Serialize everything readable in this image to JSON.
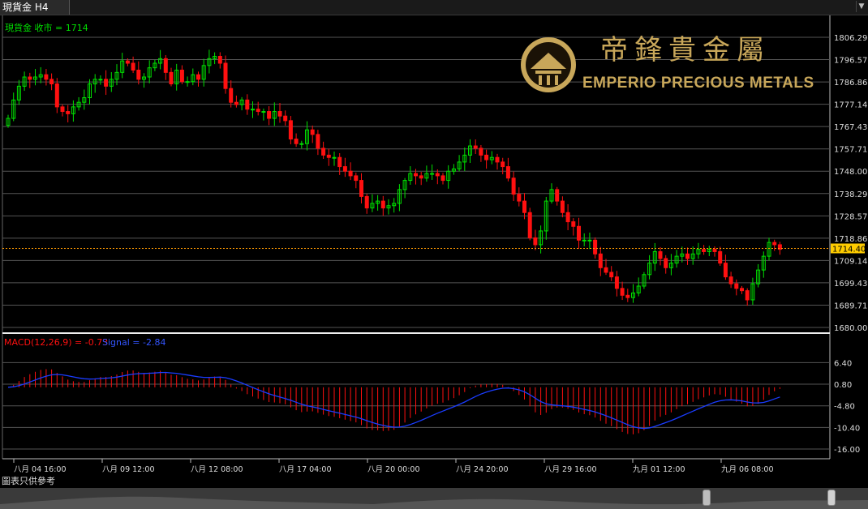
{
  "window": {
    "tab_title": "現貨金 H4",
    "corner_glyph": "▼"
  },
  "logo": {
    "chinese": "帝鋒貴金屬",
    "english": "EMPERIO PRECIOUS METALS"
  },
  "footer": {
    "label": "圖表只供參考"
  },
  "colors": {
    "up": "#00e000",
    "down": "#ff1010",
    "signal": "#1a3cff",
    "macd": "#ff1010",
    "price_line": "#ff9900",
    "grid": "#555555",
    "axis_text": "#dddddd"
  },
  "chart_data": [
    {
      "type": "candlestick",
      "legend": "現貨金 收市 = 1714",
      "current_price": 1714.4,
      "current_price_label": "1714.40",
      "ylim": [
        1680.0,
        1806.29
      ],
      "y_ticks": [
        "1806.29",
        "1796.57",
        "1786.86",
        "1777.14",
        "1767.43",
        "1757.71",
        "1748.00",
        "1738.29",
        "1728.57",
        "1718.86",
        "1709.14",
        "1699.43",
        "1689.71",
        "1680.00"
      ],
      "y_tick_values": [
        1806.29,
        1796.57,
        1786.86,
        1777.14,
        1767.43,
        1757.71,
        1748.0,
        1738.29,
        1728.57,
        1718.86,
        1709.14,
        1699.43,
        1689.71,
        1680.0
      ],
      "x_ticks": [
        "八月 04 16:00",
        "八月 09 12:00",
        "八月 12 08:00",
        "八月 17 04:00",
        "八月 20 00:00",
        "八月 24 20:00",
        "八月 29 16:00",
        "九月 01 12:00",
        "九月 06 08:00"
      ],
      "grid": true,
      "closes": [
        1771,
        1779,
        1785,
        1789,
        1788,
        1789,
        1790,
        1788,
        1786,
        1776,
        1774,
        1773,
        1776,
        1778,
        1780,
        1786,
        1788,
        1788,
        1785,
        1788,
        1791,
        1796,
        1795,
        1792,
        1788,
        1789,
        1793,
        1795,
        1797,
        1791,
        1786,
        1792,
        1787,
        1787,
        1790,
        1788,
        1794,
        1797,
        1798,
        1795,
        1784,
        1778,
        1777,
        1779,
        1775,
        1775,
        1774,
        1774,
        1771,
        1774,
        1772,
        1770,
        1762,
        1760,
        1760,
        1766,
        1764,
        1758,
        1755,
        1754,
        1754,
        1750,
        1748,
        1746,
        1744,
        1737,
        1732,
        1734,
        1735,
        1732,
        1733,
        1734,
        1740,
        1744,
        1747,
        1746,
        1745,
        1747,
        1747,
        1746,
        1744,
        1748,
        1749,
        1752,
        1755,
        1759,
        1758,
        1755,
        1753,
        1754,
        1752,
        1750,
        1745,
        1738,
        1735,
        1730,
        1719,
        1716,
        1722,
        1735,
        1740,
        1735,
        1730,
        1726,
        1724,
        1718,
        1718,
        1718,
        1712,
        1706,
        1704,
        1702,
        1697,
        1694,
        1693,
        1695,
        1698,
        1703,
        1708,
        1713,
        1710,
        1706,
        1708,
        1711,
        1712,
        1710,
        1712,
        1714,
        1713,
        1714,
        1713,
        1708,
        1702,
        1699,
        1697,
        1696,
        1692,
        1699,
        1705,
        1711,
        1717,
        1716,
        1714
      ]
    },
    {
      "type": "macd",
      "legend_macd": "MACD(12,26,9) = -0.73",
      "legend_signal": "Signal = -2.84",
      "ylim": [
        -16.0,
        9.0
      ],
      "y_ticks": [
        "6.40",
        "0.80",
        "-4.80",
        "-10.40",
        "-16.00"
      ],
      "y_tick_values": [
        6.4,
        0.8,
        -4.8,
        -10.4,
        -16.0
      ]
    }
  ]
}
